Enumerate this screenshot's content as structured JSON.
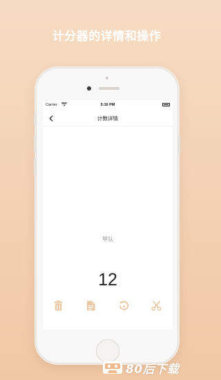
{
  "promo": {
    "headline": "计分器的详情和操作"
  },
  "status_bar": {
    "carrier": "Carrier",
    "time": "5:16 PM"
  },
  "nav": {
    "title": "计数详情",
    "back_icon": "chevron-left-icon"
  },
  "detail": {
    "team_name": "甲队",
    "count": "12"
  },
  "toolbar": {
    "icon_color": "#e9c8a6",
    "items": [
      {
        "name": "delete",
        "icon": "trash-icon"
      },
      {
        "name": "record",
        "icon": "document-icon"
      },
      {
        "name": "reset",
        "icon": "reset-icon"
      },
      {
        "name": "cut",
        "icon": "scissors-icon"
      }
    ]
  },
  "watermark": {
    "text": "80后下载"
  },
  "colors": {
    "accent": "#e9c8a6",
    "background_top": "#f6dcc3",
    "background_bottom": "#f1c8a5"
  }
}
